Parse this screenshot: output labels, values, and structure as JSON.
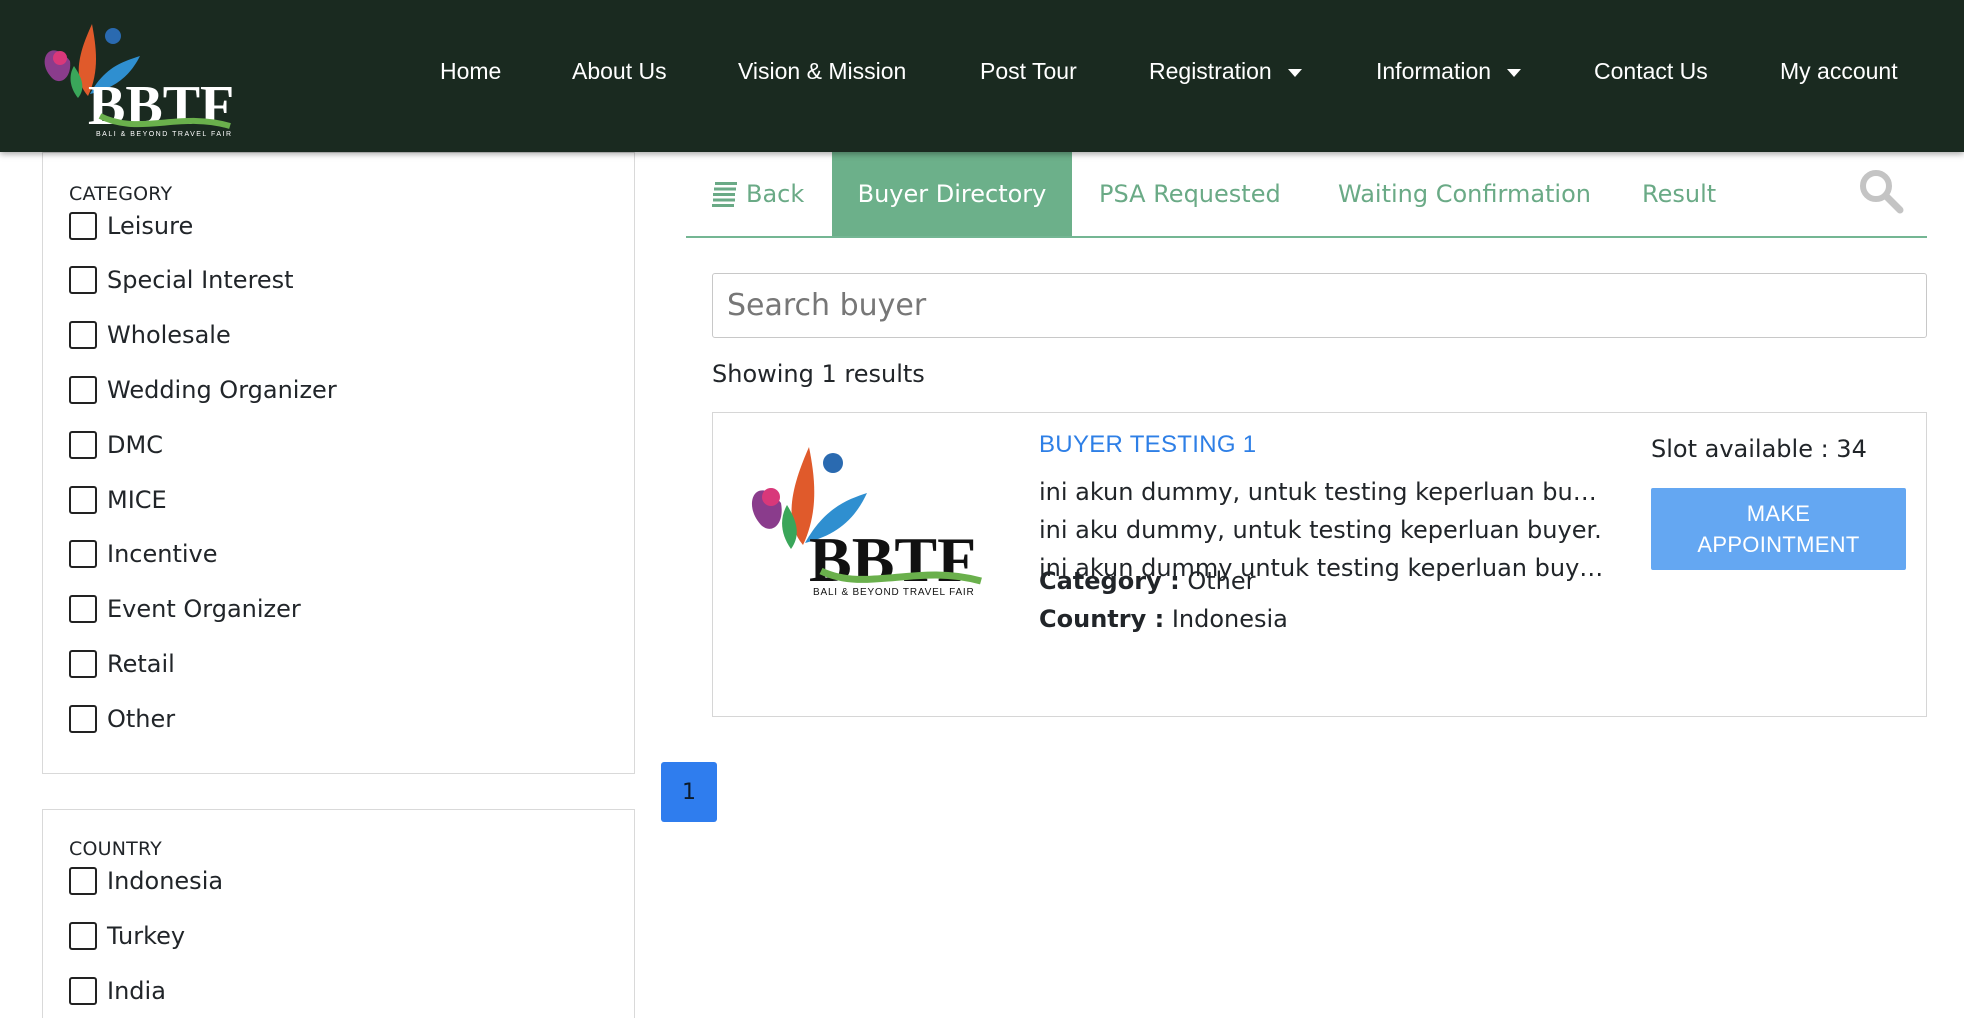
{
  "header": {
    "logo_text": "BBTF",
    "logo_subtext": "BALI & BEYOND TRAVEL FAIR",
    "nav": [
      {
        "label": "Home"
      },
      {
        "label": "About Us"
      },
      {
        "label": "Vision & Mission"
      },
      {
        "label": "Post Tour"
      },
      {
        "label": "Registration"
      },
      {
        "label": "Information"
      },
      {
        "label": "Contact Us"
      },
      {
        "label": "My account"
      }
    ]
  },
  "filters": {
    "category": {
      "title": "CATEGORY",
      "options": [
        "Leisure",
        "Special Interest",
        "Wholesale",
        "Wedding Organizer",
        "DMC",
        "MICE",
        "Incentive",
        "Event Organizer",
        "Retail",
        "Other"
      ]
    },
    "country": {
      "title": "COUNTRY",
      "options": [
        "Indonesia",
        "Turkey",
        "India"
      ]
    }
  },
  "tabs": {
    "back": "Back",
    "buyer_directory": "Buyer Directory",
    "psa_requested": "PSA Requested",
    "waiting_confirmation": "Waiting Confirmation",
    "result": "Result"
  },
  "search": {
    "placeholder": "Search buyer"
  },
  "results_count": "Showing 1 results",
  "buyer": {
    "name": "BUYER TESTING 1",
    "description": [
      "ini akun dummy, untuk testing keperluan buyer.",
      "ini aku dummy, untuk testing keperluan buyer.",
      "ini akun dummy untuk testing keperluan buye..."
    ],
    "category_label": "Category :",
    "category_value": "Other",
    "country_label": "Country :",
    "country_value": "Indonesia",
    "slot": "Slot available : 34",
    "button_line1": "MAKE",
    "button_line2": "APPOINTMENT"
  },
  "pagination": {
    "current": "1"
  },
  "colors": {
    "header_bg": "#1a2a20",
    "accent_green": "#6cb08a",
    "link_blue": "#2e7fe6",
    "button_blue": "#64a7f2",
    "page_blue": "#2f7dee"
  }
}
